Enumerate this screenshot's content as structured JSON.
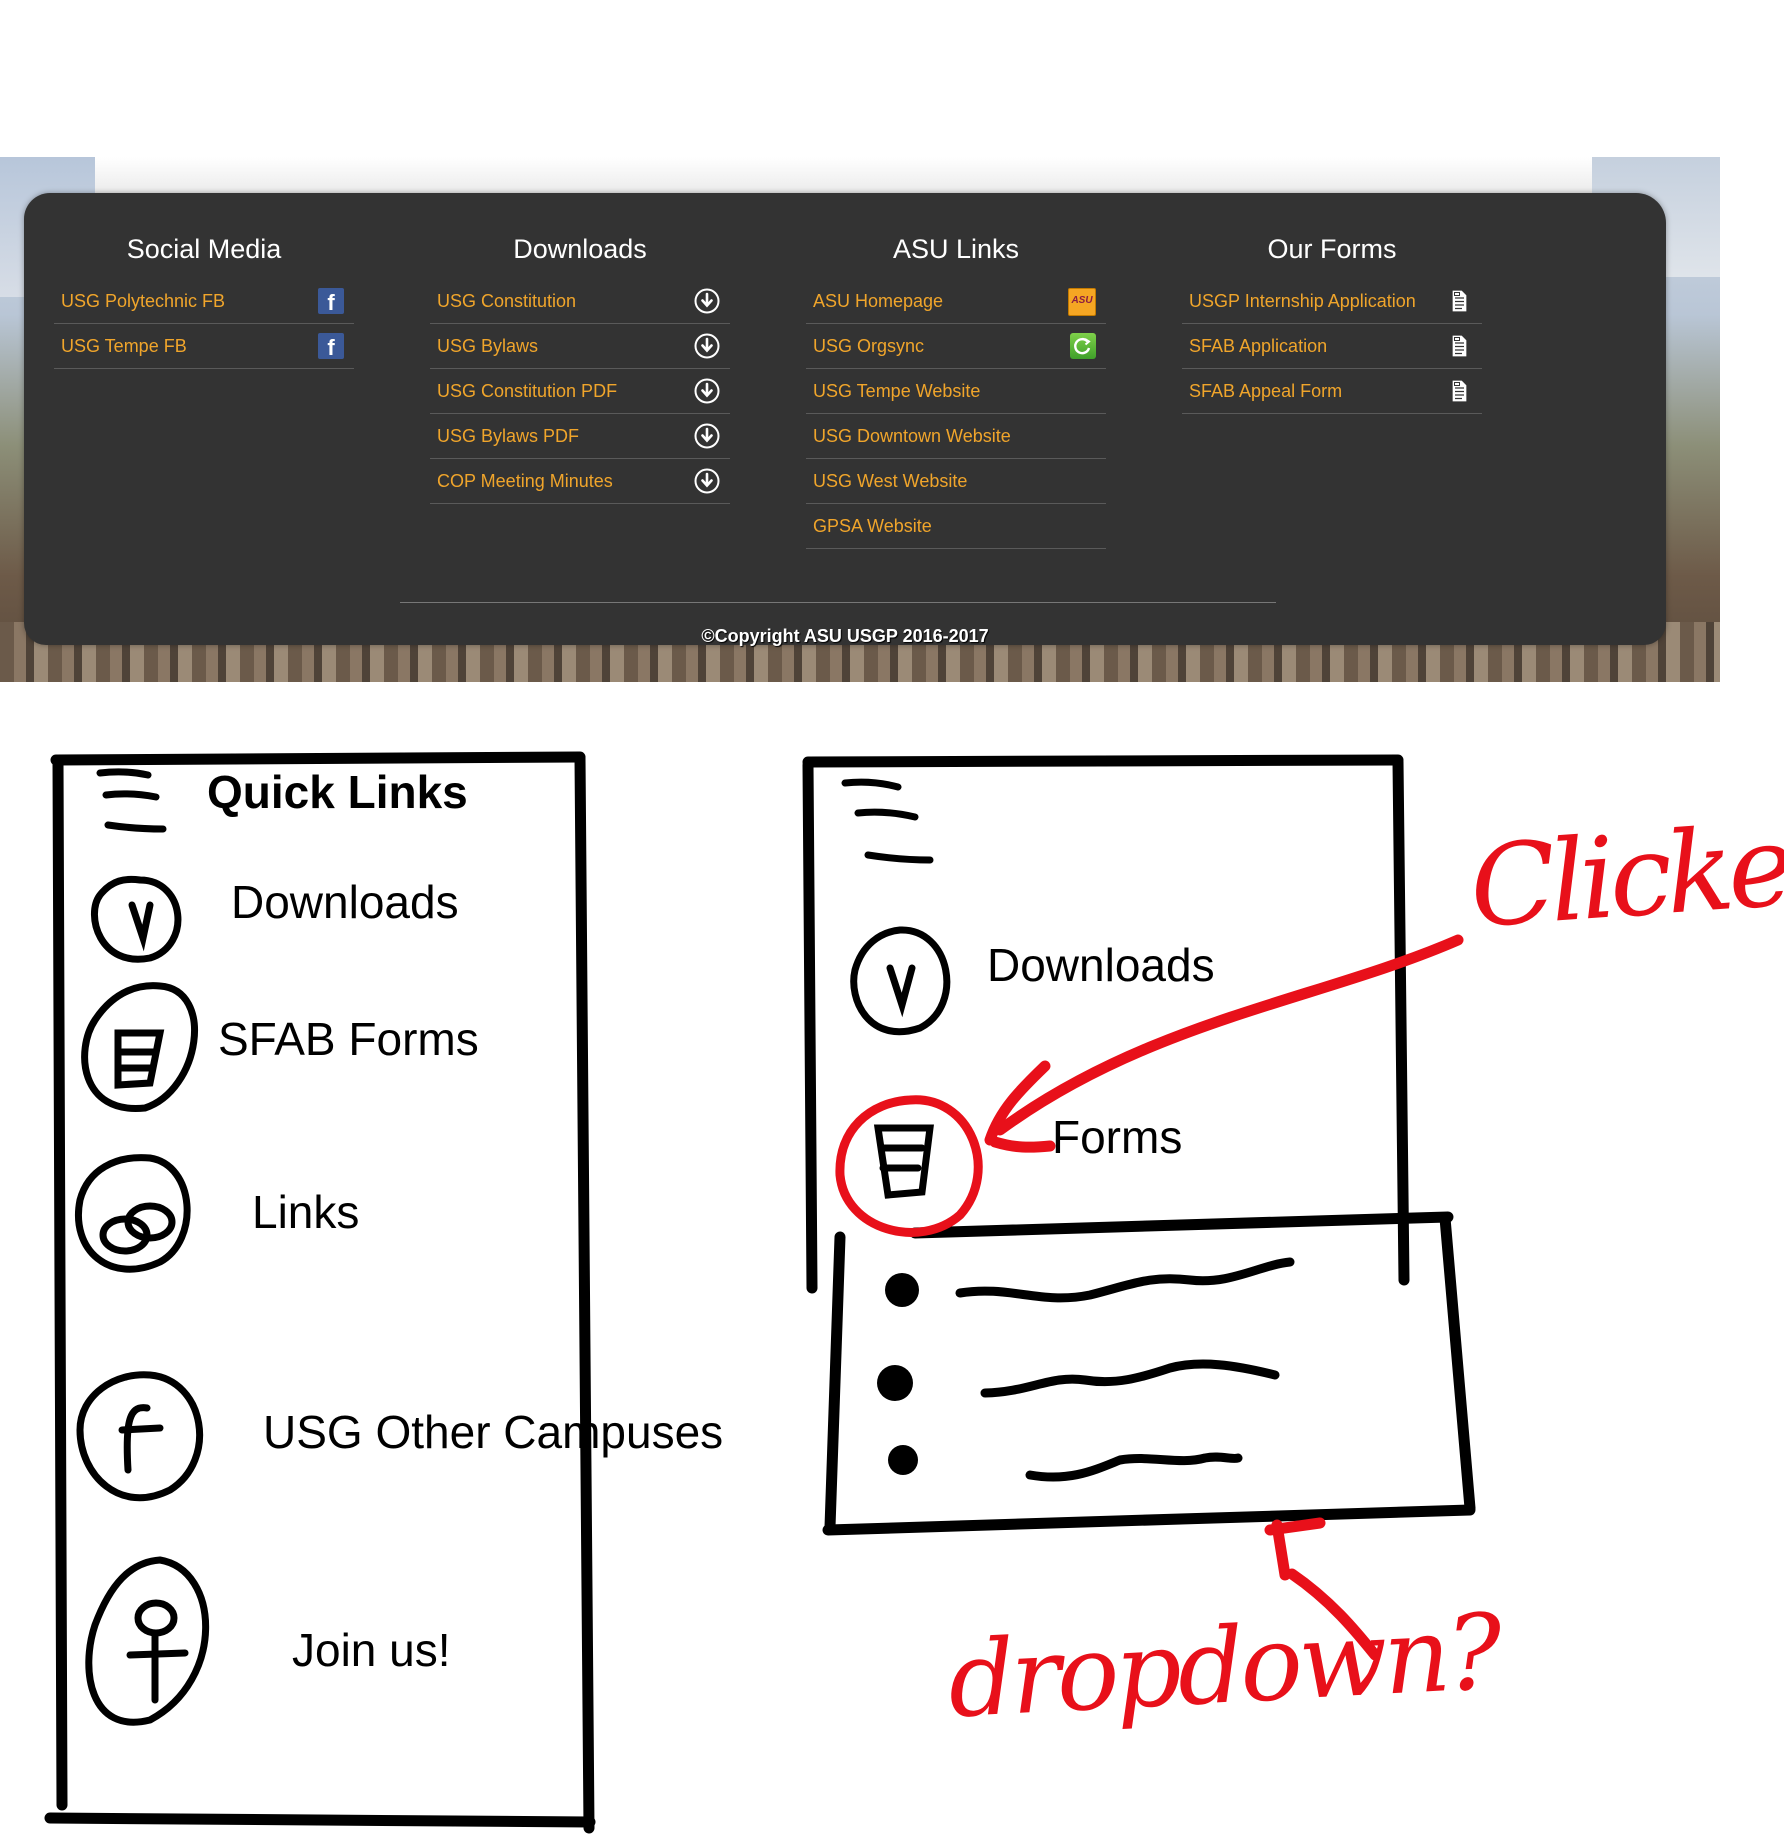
{
  "footer": {
    "columns": [
      {
        "title": "Social Media",
        "items": [
          {
            "label": "USG Polytechnic FB",
            "icon": "facebook-icon"
          },
          {
            "label": "USG Tempe FB",
            "icon": "facebook-icon"
          }
        ]
      },
      {
        "title": "Downloads",
        "items": [
          {
            "label": "USG Constitution",
            "icon": "download-icon"
          },
          {
            "label": "USG Bylaws",
            "icon": "download-icon"
          },
          {
            "label": "USG Constitution PDF",
            "icon": "download-icon"
          },
          {
            "label": "USG Bylaws PDF",
            "icon": "download-icon"
          },
          {
            "label": "COP Meeting Minutes",
            "icon": "download-icon"
          }
        ]
      },
      {
        "title": "ASU Links",
        "items": [
          {
            "label": "ASU Homepage",
            "icon": "asu-icon"
          },
          {
            "label": "USG Orgsync",
            "icon": "orgsync-icon"
          },
          {
            "label": "USG Tempe Website"
          },
          {
            "label": "USG Downtown Website"
          },
          {
            "label": "USG West Website"
          },
          {
            "label": "GPSA Website"
          }
        ]
      },
      {
        "title": "Our Forms",
        "items": [
          {
            "label": "USGP Internship Application",
            "icon": "document-icon"
          },
          {
            "label": "SFAB Application",
            "icon": "document-icon"
          },
          {
            "label": "SFAB Appeal Form",
            "icon": "document-icon"
          }
        ]
      }
    ],
    "copyright": "©Copyright ASU USGP 2016-2017",
    "link_color": "#f0a52b",
    "panel_color": "#333333",
    "asu_icon_text": "ASU",
    "facebook_glyph": "f"
  },
  "sketch_quick_links": {
    "title": "Quick Links",
    "items": [
      {
        "label": "Downloads",
        "icon": "download-icon"
      },
      {
        "label": "SFAB Forms",
        "icon": "document-icon"
      },
      {
        "label": "Links",
        "icon": "link-icon"
      },
      {
        "label": "USG Other Campuses",
        "icon": "facebook-icon"
      },
      {
        "label": "Join us!",
        "icon": "person-icon"
      }
    ]
  },
  "sketch_dropdown": {
    "items": [
      {
        "label": "Downloads",
        "icon": "download-icon"
      },
      {
        "label": "Forms",
        "icon": "document-icon"
      }
    ],
    "annotation_clicked": "Clicked",
    "annotation_dropdown": "dropdown?",
    "annotation_color": "#e8101a"
  }
}
